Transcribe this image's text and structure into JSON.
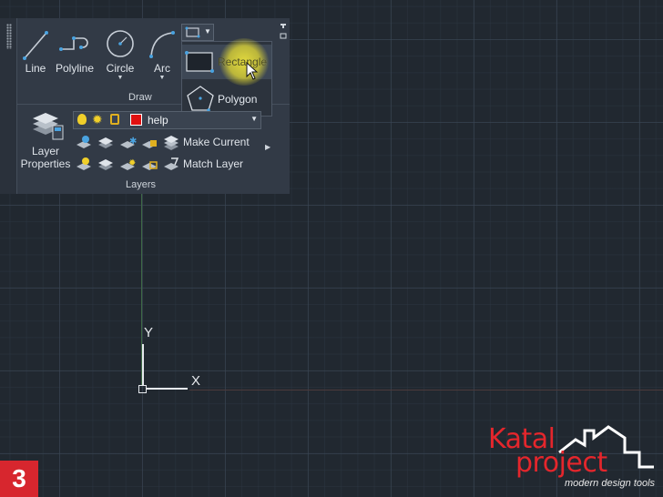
{
  "ribbon": {
    "draw": {
      "section_label": "Draw",
      "tools": [
        {
          "label": "Line",
          "icon": "line-icon"
        },
        {
          "label": "Polyline",
          "icon": "polyline-icon"
        },
        {
          "label": "Circle",
          "icon": "circle-icon"
        },
        {
          "label": "Arc",
          "icon": "arc-icon"
        }
      ],
      "dropdown_icon": "rectangle-icon",
      "flyout": [
        {
          "label": "Rectangle",
          "icon": "rectangle-icon",
          "selected": true
        },
        {
          "label": "Polygon",
          "icon": "polygon-icon",
          "selected": false
        }
      ]
    },
    "layers": {
      "section_label": "Layers",
      "layer_properties_label_1": "Layer",
      "layer_properties_label_2": "Properties",
      "current_layer": "help",
      "current_layer_color": "#e01010",
      "make_current_label": "Make Current",
      "match_layer_label": "Match Layer"
    }
  },
  "canvas": {
    "ucs_y_label": "Y",
    "ucs_x_label": "X",
    "background": "#212830"
  },
  "overlay": {
    "step_badge": "3",
    "logo_line1": "Katal",
    "logo_line2": "project",
    "logo_tagline": "modern design tools",
    "logo_color": "#e4262c"
  }
}
